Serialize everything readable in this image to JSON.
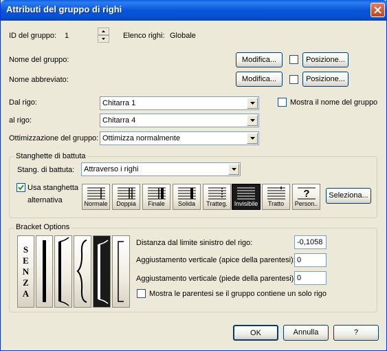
{
  "window": {
    "title": "Attributi del gruppo di righi"
  },
  "group_id": {
    "label": "ID del gruppo:",
    "value": "1"
  },
  "staff_list": {
    "label": "Elenco righi:",
    "value": "Globale"
  },
  "group_name": {
    "label": "Nome del gruppo:",
    "edit_label": "Modifica...",
    "position_label": "Posizione..."
  },
  "short_name": {
    "label": "Nome abbreviato:",
    "edit_label": "Modifica...",
    "position_label": "Posizione..."
  },
  "from_staff": {
    "label": "Dal rigo:",
    "value": "Chitarra 1"
  },
  "show_group_name": {
    "label": "Mostra il nome del gruppo",
    "checked": false
  },
  "to_staff": {
    "label": "al rigo:",
    "value": "Chitarra 4"
  },
  "optimization": {
    "label": "Ottimizzazione del gruppo:",
    "value": "Ottimizza normalmente"
  },
  "barlines": {
    "group_title": "Stanghette di battuta",
    "label": "Stang. di battuta:",
    "value": "Attraverso i righi",
    "use_alternate_label_1": "Usa stanghetta",
    "use_alternate_label_2": "alternativa",
    "use_alternate_checked": true,
    "styles": [
      {
        "label": "Normale",
        "icon": "normal-barline-icon"
      },
      {
        "label": "Doppia",
        "icon": "double-barline-icon"
      },
      {
        "label": "Finale",
        "icon": "final-barline-icon"
      },
      {
        "label": "Solida",
        "icon": "solid-barline-icon"
      },
      {
        "label": "Tratteg.",
        "icon": "dashed-barline-icon"
      },
      {
        "label": "Invisibile",
        "icon": "invisible-barline-icon",
        "selected": true
      },
      {
        "label": "Tratto",
        "icon": "tick-barline-icon"
      },
      {
        "label": "Person..",
        "icon": "custom-barline-icon"
      }
    ],
    "select_label": "Seleziona..."
  },
  "brackets": {
    "group_title": "Bracket Options",
    "none_letters": [
      "S",
      "E",
      "N",
      "Z",
      "A"
    ],
    "styles": [
      {
        "icon": "no-bracket-icon"
      },
      {
        "icon": "thick-line-bracket-icon"
      },
      {
        "icon": "bracket-icon"
      },
      {
        "icon": "curly-brace-icon"
      },
      {
        "icon": "piano-bracket-icon",
        "selected": true
      },
      {
        "icon": "thin-bracket-icon"
      }
    ],
    "distance_label": "Distanza dal limite sinistro del rigo:",
    "distance_value": "-0,1058",
    "top_adjust_label": "Aggiustamento verticale (apice della parentesi):",
    "top_adjust_value": "0",
    "bottom_adjust_label": "Aggiustamento verticale (piede della parentesi):",
    "bottom_adjust_value": "0",
    "single_staff_label": "Mostra le parentesi se il gruppo contiene un solo rigo",
    "single_staff_checked": false
  },
  "footer": {
    "ok_label": "OK",
    "cancel_label": "Annulla",
    "help_label": "?"
  }
}
